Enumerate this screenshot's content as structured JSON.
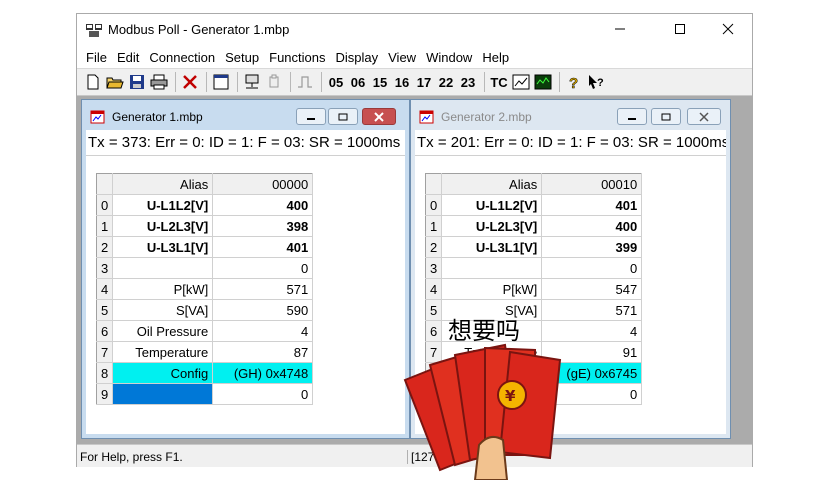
{
  "app": {
    "title": "Modbus Poll - Generator 1.mbp"
  },
  "menu": [
    "File",
    "Edit",
    "Connection",
    "Setup",
    "Functions",
    "Display",
    "View",
    "Window",
    "Help"
  ],
  "toolbar": {
    "function_codes": [
      "05",
      "06",
      "15",
      "16",
      "17",
      "22",
      "23"
    ],
    "tc_label": "TC"
  },
  "windows": [
    {
      "title": "Generator 1.mbp",
      "status": "Tx = 373: Err = 0: ID = 1: F = 03: SR = 1000ms",
      "header": {
        "alias": "Alias",
        "address": "00000"
      },
      "rows": [
        {
          "n": "0",
          "alias": "U-L1L2[V]",
          "value": "400"
        },
        {
          "n": "1",
          "alias": "U-L2L3[V]",
          "value": "398"
        },
        {
          "n": "2",
          "alias": "U-L3L1[V]",
          "value": "401"
        },
        {
          "n": "3",
          "alias": "",
          "value": "0"
        },
        {
          "n": "4",
          "alias": "P[kW]",
          "value": "571"
        },
        {
          "n": "5",
          "alias": "S[VA]",
          "value": "590"
        },
        {
          "n": "6",
          "alias": "Oil Pressure",
          "value": "4"
        },
        {
          "n": "7",
          "alias": "Temperature",
          "value": "87"
        },
        {
          "n": "8",
          "alias": "Config",
          "value": "(GH) 0x4748"
        },
        {
          "n": "9",
          "alias": "",
          "value": "0"
        }
      ]
    },
    {
      "title": "Generator 2.mbp",
      "status": "Tx = 201: Err = 0: ID = 1: F = 03: SR = 1000ms",
      "header": {
        "alias": "Alias",
        "address": "00010"
      },
      "rows": [
        {
          "n": "0",
          "alias": "U-L1L2[V]",
          "value": "401"
        },
        {
          "n": "1",
          "alias": "U-L2L3[V]",
          "value": "400"
        },
        {
          "n": "2",
          "alias": "U-L3L1[V]",
          "value": "399"
        },
        {
          "n": "3",
          "alias": "",
          "value": "0"
        },
        {
          "n": "4",
          "alias": "P[kW]",
          "value": "547"
        },
        {
          "n": "5",
          "alias": "S[VA]",
          "value": "571"
        },
        {
          "n": "6",
          "alias": "",
          "value": "4"
        },
        {
          "n": "7",
          "alias": "Temperature",
          "value": "91"
        },
        {
          "n": "8",
          "alias": "",
          "value": "(gE) 0x6745"
        },
        {
          "n": "9",
          "alias": "",
          "value": "0"
        }
      ]
    }
  ],
  "statusbar": {
    "help": "For Help, press F1.",
    "right": "[127"
  },
  "overlay": {
    "text": "想要吗"
  },
  "colors": {
    "highlight_row": "#00f0f0",
    "selected_cell": "#0078d7",
    "envelope": "#d9261c",
    "coin": "#f4b400"
  }
}
